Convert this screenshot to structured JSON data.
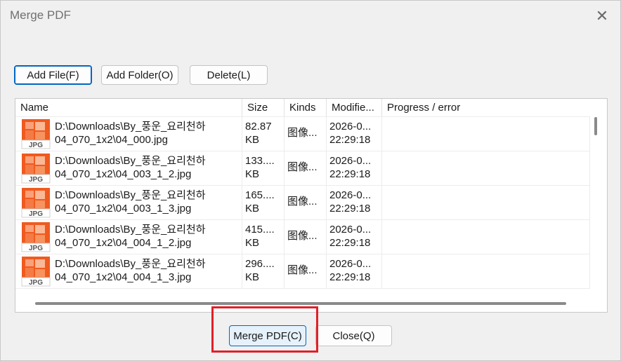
{
  "window": {
    "title": "Merge PDF"
  },
  "toolbar": {
    "add_file": "Add File(F)",
    "add_folder": "Add Folder(O)",
    "delete": "Delete(L)"
  },
  "columns": [
    "Name",
    "Size",
    "Kinds",
    "Modifie...",
    "Progress / error"
  ],
  "rows": [
    {
      "name_line1": "D:\\Downloads\\By_풍운_요리천하",
      "name_line2": "04_070_1x2\\04_000.jpg",
      "size_line1": "82.87",
      "size_line2": "KB",
      "kind": "图像...",
      "mod_line1": "2026-0...",
      "mod_line2": "22:29:18",
      "progress": ""
    },
    {
      "name_line1": "D:\\Downloads\\By_풍운_요리천하",
      "name_line2": "04_070_1x2\\04_003_1_2.jpg",
      "size_line1": "133....",
      "size_line2": "KB",
      "kind": "图像...",
      "mod_line1": "2026-0...",
      "mod_line2": "22:29:18",
      "progress": ""
    },
    {
      "name_line1": "D:\\Downloads\\By_풍운_요리천하",
      "name_line2": "04_070_1x2\\04_003_1_3.jpg",
      "size_line1": "165....",
      "size_line2": "KB",
      "kind": "图像...",
      "mod_line1": "2026-0...",
      "mod_line2": "22:29:18",
      "progress": ""
    },
    {
      "name_line1": "D:\\Downloads\\By_풍운_요리천하",
      "name_line2": "04_070_1x2\\04_004_1_2.jpg",
      "size_line1": "415....",
      "size_line2": "KB",
      "kind": "图像...",
      "mod_line1": "2026-0...",
      "mod_line2": "22:29:18",
      "progress": ""
    },
    {
      "name_line1": "D:\\Downloads\\By_풍운_요리천하",
      "name_line2": "04_070_1x2\\04_004_1_3.jpg",
      "size_line1": "296....",
      "size_line2": "KB",
      "kind": "图像...",
      "mod_line1": "2026-0...",
      "mod_line2": "22:29:18",
      "progress": ""
    }
  ],
  "icons": {
    "file_type_label": "JPG",
    "file_icon_color": "#f05a1e",
    "close": "close-icon"
  },
  "footer": {
    "merge": "Merge PDF(C)",
    "close": "Close(Q)"
  },
  "colors": {
    "highlight": "#e0202a",
    "accent": "#0067c0"
  }
}
